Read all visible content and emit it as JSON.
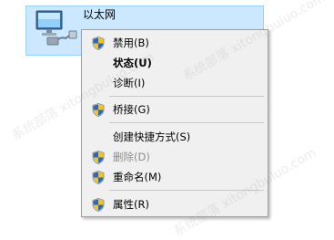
{
  "network_item": {
    "title": "以太网",
    "icon": "network-adapter-icon"
  },
  "context_menu": {
    "items": [
      {
        "label": "禁用(B)",
        "shield": true,
        "bold": false,
        "disabled": false
      },
      {
        "label": "状态(U)",
        "shield": false,
        "bold": true,
        "disabled": false
      },
      {
        "label": "诊断(I)",
        "shield": false,
        "bold": false,
        "disabled": false
      },
      {
        "label": "桥接(G)",
        "shield": true,
        "bold": false,
        "disabled": false
      },
      {
        "label": "创建快捷方式(S)",
        "shield": false,
        "bold": false,
        "disabled": false
      },
      {
        "label": "删除(D)",
        "shield": true,
        "bold": false,
        "disabled": true
      },
      {
        "label": "重命名(M)",
        "shield": true,
        "bold": false,
        "disabled": false
      },
      {
        "label": "属性(R)",
        "shield": true,
        "bold": false,
        "disabled": false
      }
    ]
  },
  "watermark": {
    "text": "系统部落 xitongbuluo.com"
  }
}
